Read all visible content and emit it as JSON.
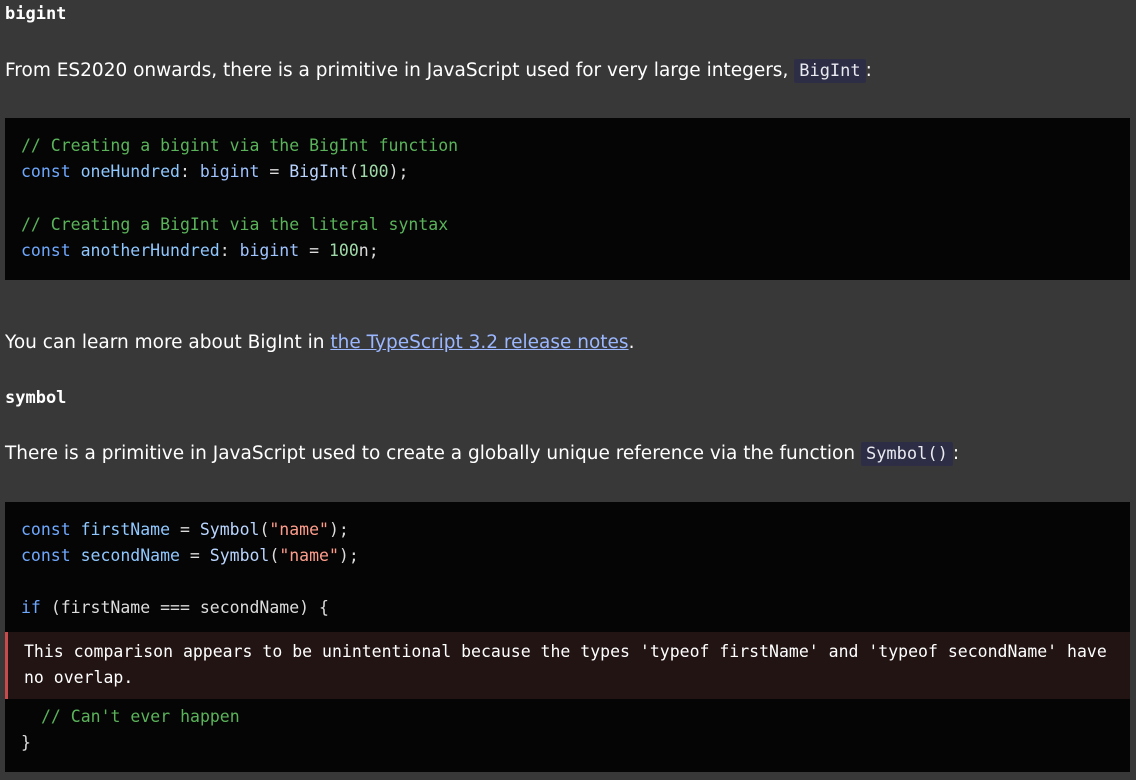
{
  "bigint": {
    "heading": "bigint",
    "intro_text": "From ES2020 onwards, there is a primitive in JavaScript used for very large integers,",
    "intro_code": "BigInt",
    "intro_after": ":",
    "code": {
      "comment1": "// Creating a bigint via the BigInt function",
      "line2_const": "const",
      "line2_var": "oneHundred",
      "line2_colon": ":",
      "line2_type": "bigint",
      "line2_eq": "=",
      "line2_fn": "BigInt",
      "line2_open": "(",
      "line2_num": "100",
      "line2_close": ");",
      "comment2": "// Creating a BigInt via the literal syntax",
      "line5_const": "const",
      "line5_var": "anotherHundred",
      "line5_colon": ":",
      "line5_type": "bigint",
      "line5_eq": "=",
      "line5_num": "100",
      "line5_suffix": "n;"
    },
    "learn_prefix": "You can learn more about BigInt in",
    "learn_link": "the TypeScript 3.2 release notes",
    "learn_suffix": "."
  },
  "symbol": {
    "heading": "symbol",
    "intro_text": "There is a primitive in JavaScript used to create a globally unique reference via the function",
    "intro_code": "Symbol()",
    "intro_after": ":",
    "code": {
      "l1_const": "const",
      "l1_var": "firstName",
      "l1_eq": "=",
      "l1_fn": "Symbol",
      "l1_open": "(",
      "l1_str": "\"name\"",
      "l1_close": ");",
      "l2_const": "const",
      "l2_var": "secondName",
      "l2_eq": "=",
      "l2_fn": "Symbol",
      "l2_open": "(",
      "l2_str": "\"name\"",
      "l2_close": ");",
      "l4_if": "if",
      "l4_rest": "(firstName === secondName) {",
      "error": "This comparison appears to be unintentional because the types 'typeof firstName' and 'typeof secondName' have no overlap.",
      "l6_comment": "// Can't ever happen",
      "l7_close": "}"
    }
  },
  "colors": {
    "background": "#383838",
    "code_background": "#050505",
    "link": "#9bb7ff",
    "error_border": "#c94a4a"
  }
}
